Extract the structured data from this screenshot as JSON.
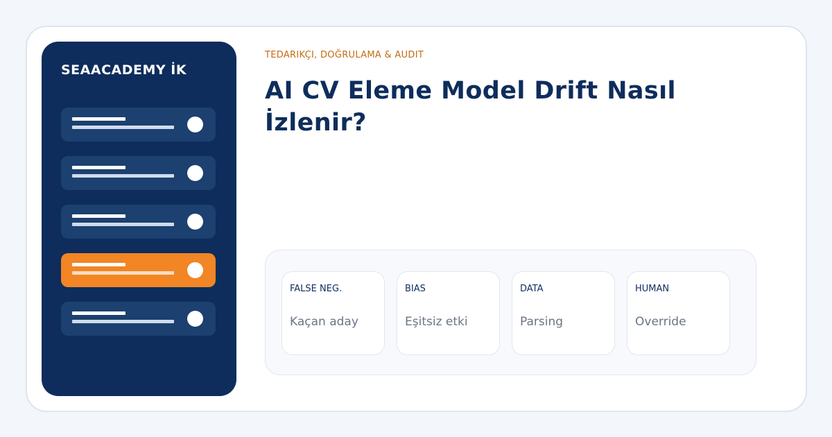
{
  "brand": "SEAACADEMY İK",
  "eyebrow": "TEDARIKÇI, DOĞRULAMA & AUDIT",
  "title": "AI CV Eleme Model Drift Nasıl İzlenir?",
  "nav": {
    "active_index": 3,
    "item_count": 5
  },
  "colors": {
    "background": "#f3f6fa",
    "sidebar": "#0e2d5c",
    "nav_item": "#1c406f",
    "accent": "#f28524",
    "eyebrow": "#c46b12",
    "title": "#0e2d5c"
  },
  "metrics": [
    {
      "label": "FALSE NEG.",
      "value": "Kaçan aday"
    },
    {
      "label": "BIAS",
      "value": "Eşitsiz etki"
    },
    {
      "label": "DATA",
      "value": "Parsing"
    },
    {
      "label": "HUMAN",
      "value": "Override"
    }
  ]
}
